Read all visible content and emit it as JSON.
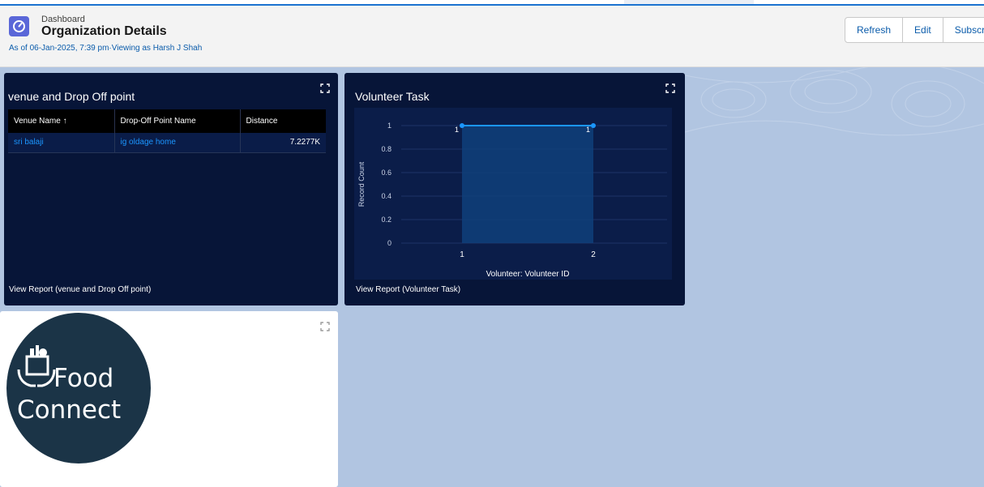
{
  "header": {
    "kicker": "Dashboard",
    "title": "Organization Details",
    "subtitle": "As of 06-Jan-2025, 7:39 pm·Viewing as Harsh J Shah",
    "buttons": {
      "refresh": "Refresh",
      "edit": "Edit",
      "subscribe": "Subscribe"
    }
  },
  "venue_panel": {
    "title": "venue and Drop Off point",
    "columns": [
      "Venue Name ↑",
      "Drop-Off Point Name",
      "Distance"
    ],
    "rows": [
      {
        "venue": "sri balaji",
        "dropoff": "ig oldage home",
        "distance": "7.2277K"
      }
    ],
    "view_report": "View Report (venue and Drop Off point)"
  },
  "volunteer_panel": {
    "title": "Volunteer Task",
    "view_report": "View Report (Volunteer Task)"
  },
  "chart_data": {
    "type": "area",
    "x": [
      "1",
      "2"
    ],
    "series": [
      {
        "values": [
          1,
          1
        ]
      }
    ],
    "data_labels": [
      "1",
      "1"
    ],
    "xlabel": "Volunteer: Volunteer ID",
    "ylabel": "Record Count",
    "ylim": [
      0,
      1
    ],
    "yticks": [
      "0",
      "0.2",
      "0.4",
      "0.6",
      "0.8",
      "1"
    ],
    "grid": true,
    "colors": {
      "line": "#1b96ff",
      "fill": "#0f3f7a"
    }
  },
  "logo": {
    "line1": "Food",
    "line2": "Connect"
  },
  "colors": {
    "accent": "#1b73d0",
    "panel": "#071538",
    "canvas": "#b1c5e1",
    "link": "#1b96ff"
  }
}
